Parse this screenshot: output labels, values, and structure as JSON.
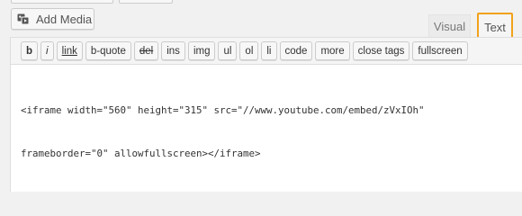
{
  "media": {
    "add_label": "Add Media"
  },
  "tabs": {
    "visual": "Visual",
    "text": "Text"
  },
  "toolbar": {
    "buttons": [
      "b",
      "i",
      "link",
      "b-quote",
      "del",
      "ins",
      "img",
      "ul",
      "ol",
      "li",
      "code",
      "more",
      "close tags",
      "fullscreen"
    ]
  },
  "editor": {
    "lines": [
      "<iframe width=\"560\" height=\"315\" src=\"//www.youtube.com/embed/zVxIOh\"",
      "frameborder=\"0\" allowfullscreen></iframe>"
    ]
  }
}
